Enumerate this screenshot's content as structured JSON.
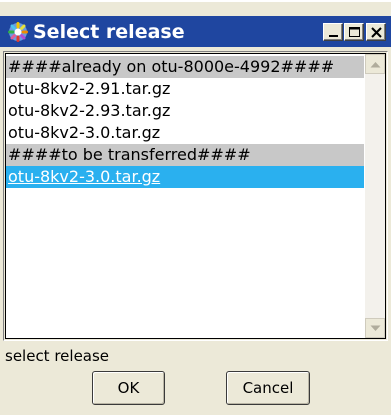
{
  "window": {
    "title": "Select release",
    "icon": "gear-app-icon"
  },
  "list": {
    "rows": [
      {
        "text": "####already on otu-8000e-4992####",
        "kind": "header"
      },
      {
        "text": "otu-8kv2-2.91.tar.gz",
        "kind": "item"
      },
      {
        "text": "otu-8kv2-2.93.tar.gz",
        "kind": "item"
      },
      {
        "text": "otu-8kv2-3.0.tar.gz",
        "kind": "item"
      },
      {
        "text": "####to be transferred####",
        "kind": "header"
      },
      {
        "text": "otu-8kv2-3.0.tar.gz",
        "kind": "selected"
      }
    ]
  },
  "status": {
    "text": "select release"
  },
  "buttons": {
    "ok": "OK",
    "cancel": "Cancel"
  },
  "colors": {
    "titlebar": "#1f46a0",
    "selection": "#2ab0ef",
    "header_row": "#c8c8c8",
    "face": "#ece9d8"
  }
}
